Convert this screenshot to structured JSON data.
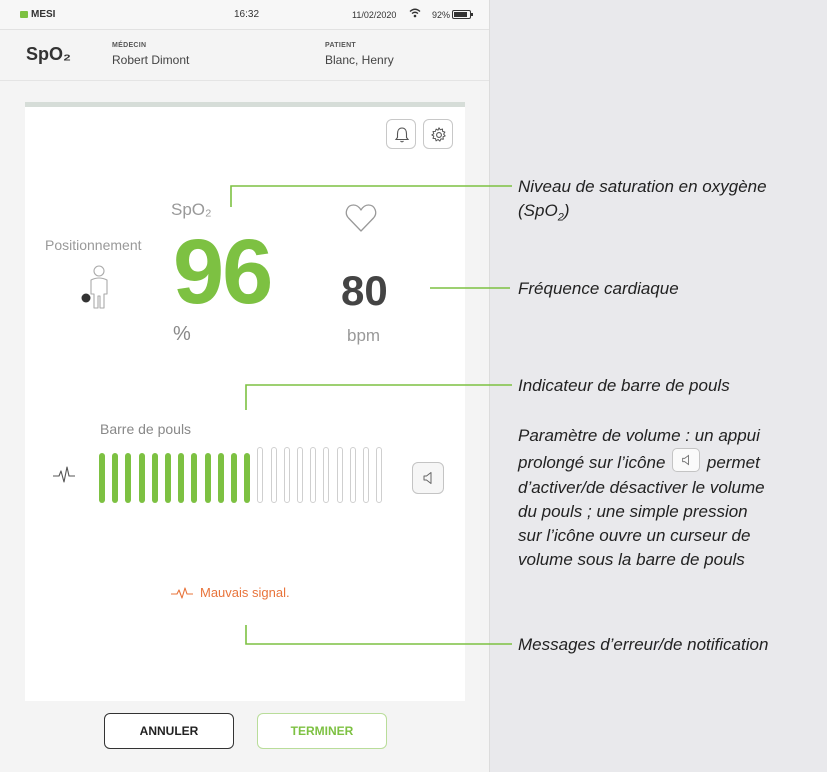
{
  "status_bar": {
    "brand": "MESI",
    "time": "16:32",
    "date": "11/02/2020",
    "battery": "92%"
  },
  "header": {
    "title": "SpO₂",
    "doctor_label": "MÉDECIN",
    "doctor_name": "Robert Dimont",
    "patient_label": "PATIENT",
    "patient_name": "Blanc, Henry"
  },
  "measurement": {
    "spo2_label": "SpO₂",
    "spo2_value": "96",
    "spo2_unit": "%",
    "positioning_label": "Positionnement",
    "heart_rate_value": "80",
    "heart_rate_unit": "bpm",
    "pulse_bar_label": "Barre de pouls",
    "pulse_bar": {
      "active": 12,
      "total": 22
    },
    "error_message": "Mauvais signal."
  },
  "buttons": {
    "cancel": "ANNULER",
    "finish": "TERMINER"
  },
  "annotations": {
    "spo2_line1": "Niveau de saturation en oxygène",
    "spo2_line2": "(SpO",
    "spo2_line2_sub": "2",
    "spo2_line2_end": ")",
    "heart_rate": "Fréquence cardiaque",
    "pulse_bar": "Indicateur de barre de pouls",
    "volume_l1": "Paramètre de volume : un appui",
    "volume_l2a": "prolongé sur l’icône",
    "volume_l2b": "permet",
    "volume_l3": "d’activer/de désactiver le volume",
    "volume_l4": "du pouls ; une simple pression",
    "volume_l5": "sur l’icône ouvre un curseur de",
    "volume_l6": "volume sous la barre de pouls",
    "messages": "Messages d’erreur/de notification"
  },
  "colors": {
    "accent_green": "#7dc142",
    "error_orange": "#e8743b"
  },
  "icons": [
    "bell-icon",
    "gear-icon",
    "heart-icon",
    "person-icon",
    "pulse-wave-icon",
    "speaker-icon",
    "wifi-icon",
    "battery-icon"
  ]
}
